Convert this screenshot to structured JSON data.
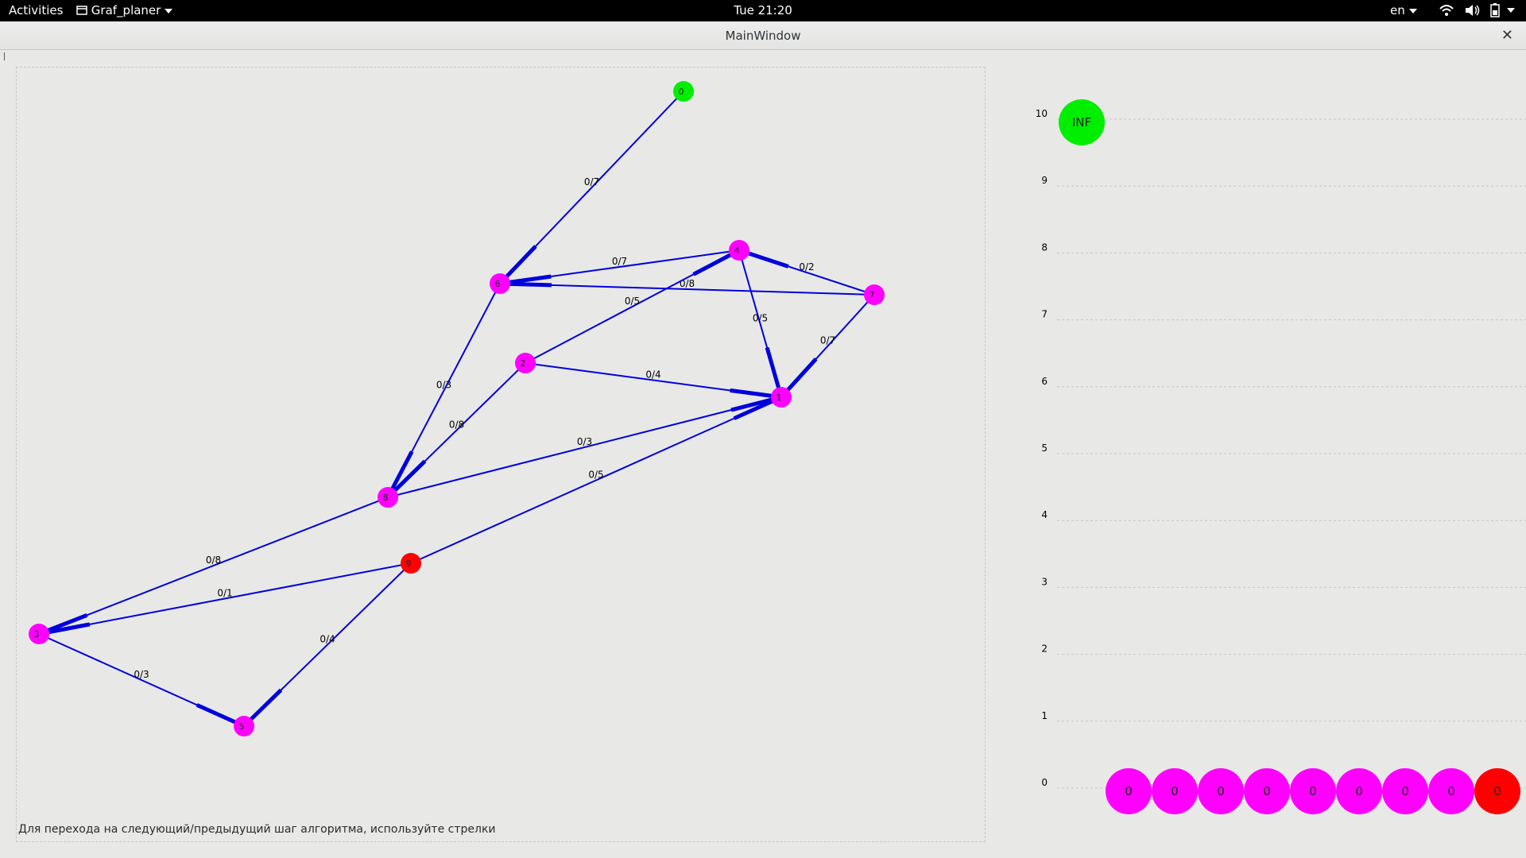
{
  "topbar": {
    "activities": "Activities",
    "app_name": "Graf_planer",
    "clock": "Tue 21:20",
    "lang": "en"
  },
  "window": {
    "title": "MainWindow",
    "close_glyph": "✕"
  },
  "status_hint": "Для перехода на следующий/предыдущий шаг алгоритма, используйте стрелки",
  "colors": {
    "source": "#00ee00",
    "sink": "#ff0000",
    "node": "#ff00ff",
    "edge": "#0000dd"
  },
  "graph": {
    "nodes": [
      {
        "id": "0",
        "role": "source"
      },
      {
        "id": "6",
        "role": "normal"
      },
      {
        "id": "4",
        "role": "normal"
      },
      {
        "id": "7",
        "role": "normal"
      },
      {
        "id": "2",
        "role": "normal"
      },
      {
        "id": "1",
        "role": "normal"
      },
      {
        "id": "8",
        "role": "normal"
      },
      {
        "id": "9",
        "role": "sink"
      },
      {
        "id": "3",
        "role": "normal"
      },
      {
        "id": "5",
        "role": "normal"
      }
    ],
    "edges": [
      {
        "from": "0",
        "to": "6",
        "label": "0/7"
      },
      {
        "from": "4",
        "to": "6",
        "label": "0/7"
      },
      {
        "from": "7",
        "to": "6",
        "label": "0/8"
      },
      {
        "from": "2",
        "to": "4",
        "label": "0/5"
      },
      {
        "from": "7",
        "to": "4",
        "label": "0/2"
      },
      {
        "from": "4",
        "to": "1",
        "label": "0/5"
      },
      {
        "from": "7",
        "to": "1",
        "label": "0/7"
      },
      {
        "from": "2",
        "to": "1",
        "label": "0/4"
      },
      {
        "from": "6",
        "to": "8",
        "label": "0/3"
      },
      {
        "from": "2",
        "to": "8",
        "label": "0/8"
      },
      {
        "from": "8",
        "to": "1",
        "label": "0/3"
      },
      {
        "from": "9",
        "to": "1",
        "label": "0/5"
      },
      {
        "from": "8",
        "to": "3",
        "label": "0/8"
      },
      {
        "from": "9",
        "to": "3",
        "label": "0/1"
      },
      {
        "from": "3",
        "to": "5",
        "label": "0/3"
      },
      {
        "from": "9",
        "to": "5",
        "label": "0/4"
      }
    ]
  },
  "height_chart": {
    "axis_labels": [
      "0",
      "1",
      "2",
      "3",
      "4",
      "5",
      "6",
      "7",
      "8",
      "9",
      "10"
    ],
    "top_node": {
      "level": 10,
      "label": "INF",
      "role": "source"
    },
    "bottom_nodes": [
      {
        "label": "0",
        "role": "normal"
      },
      {
        "label": "0",
        "role": "normal"
      },
      {
        "label": "0",
        "role": "normal"
      },
      {
        "label": "0",
        "role": "normal"
      },
      {
        "label": "0",
        "role": "normal"
      },
      {
        "label": "0",
        "role": "normal"
      },
      {
        "label": "0",
        "role": "normal"
      },
      {
        "label": "0",
        "role": "normal"
      },
      {
        "label": "0",
        "role": "sink"
      }
    ]
  }
}
